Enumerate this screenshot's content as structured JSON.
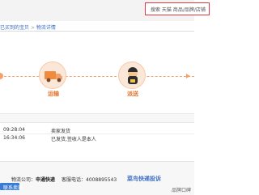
{
  "search": {
    "placeholder": "搜索 天猫 商品/品牌/店铺"
  },
  "breadcrumb": {
    "home": "已买到的宝贝",
    "separator": ">",
    "current": "物流详情"
  },
  "steps": [
    {
      "label": "运输",
      "icon": "truck-icon"
    },
    {
      "label": "派送",
      "icon": "courier-icon"
    }
  ],
  "logs": [
    {
      "time": "09:28:04",
      "text": "卖家发货"
    },
    {
      "time": "16:34:06",
      "text": "已发货,签收人是本人"
    }
  ],
  "shipment": {
    "company_label": "物流公司：",
    "company_name": "申通快递",
    "phone_label": "客服电话：",
    "phone": "4008895543",
    "feedback_link": "菜鸟快递投诉",
    "contact_button": "联系卖家",
    "rating_label": "品牌口碑"
  },
  "colors": {
    "accent": "#e7752d",
    "link": "#3a6cc6",
    "search_border": "#e4393c"
  }
}
